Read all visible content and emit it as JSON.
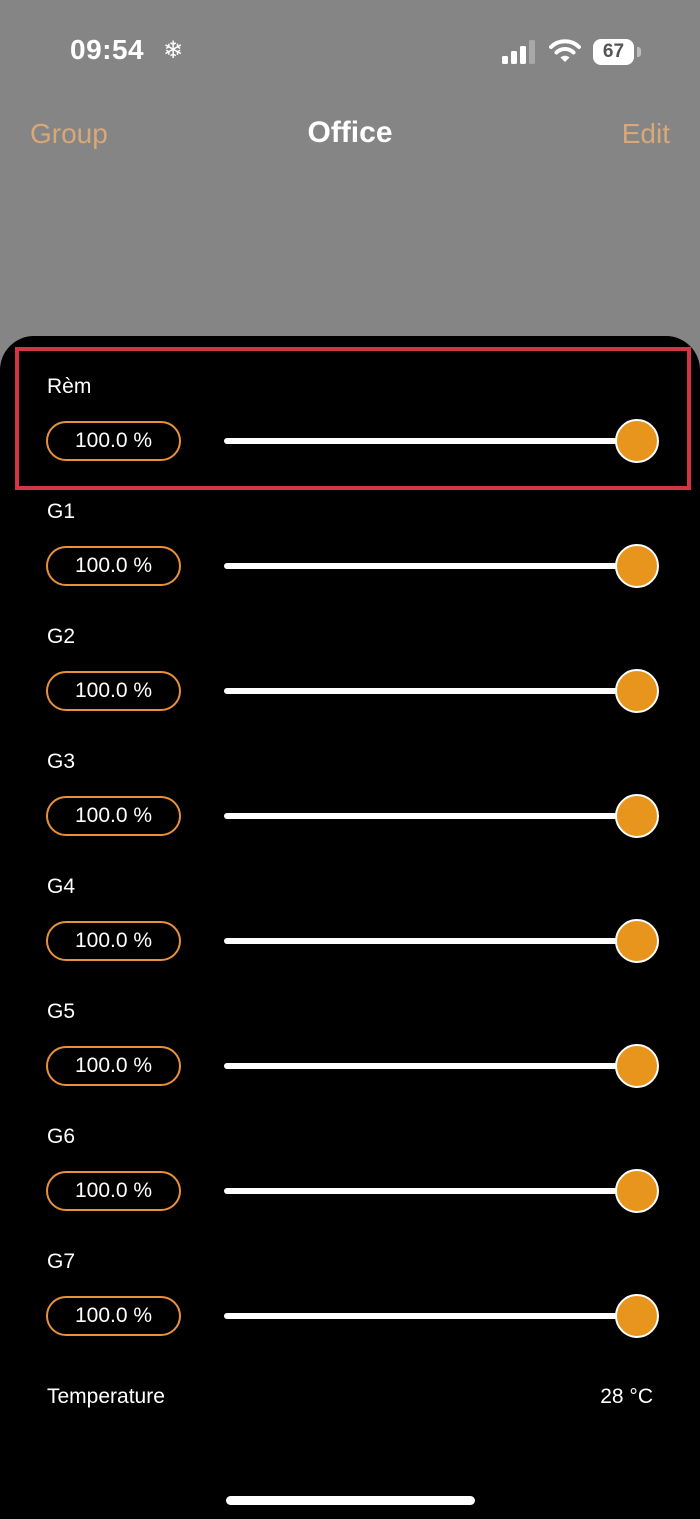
{
  "status_bar": {
    "time": "09:54",
    "extra_icon": "snowflake-icon",
    "battery_level": "67"
  },
  "nav": {
    "left_label": "Group",
    "title": "Office",
    "right_label": "Edit"
  },
  "colors": {
    "accent_orange": "#e8951d",
    "nav_link": "#d7a878",
    "highlight_red": "#d23645",
    "background_gray": "#858585"
  },
  "channels": [
    {
      "label": "Rèm",
      "value_text": "100.0 %",
      "level": 1.0,
      "highlighted": true
    },
    {
      "label": "G1",
      "value_text": "100.0 %",
      "level": 1.0
    },
    {
      "label": "G2",
      "value_text": "100.0 %",
      "level": 1.0
    },
    {
      "label": "G3",
      "value_text": "100.0 %",
      "level": 1.0
    },
    {
      "label": "G4",
      "value_text": "100.0 %",
      "level": 1.0
    },
    {
      "label": "G5",
      "value_text": "100.0 %",
      "level": 1.0
    },
    {
      "label": "G6",
      "value_text": "100.0 %",
      "level": 1.0
    },
    {
      "label": "G7",
      "value_text": "100.0 %",
      "level": 1.0
    }
  ],
  "temperature": {
    "label": "Temperature",
    "value": "28 °C"
  }
}
